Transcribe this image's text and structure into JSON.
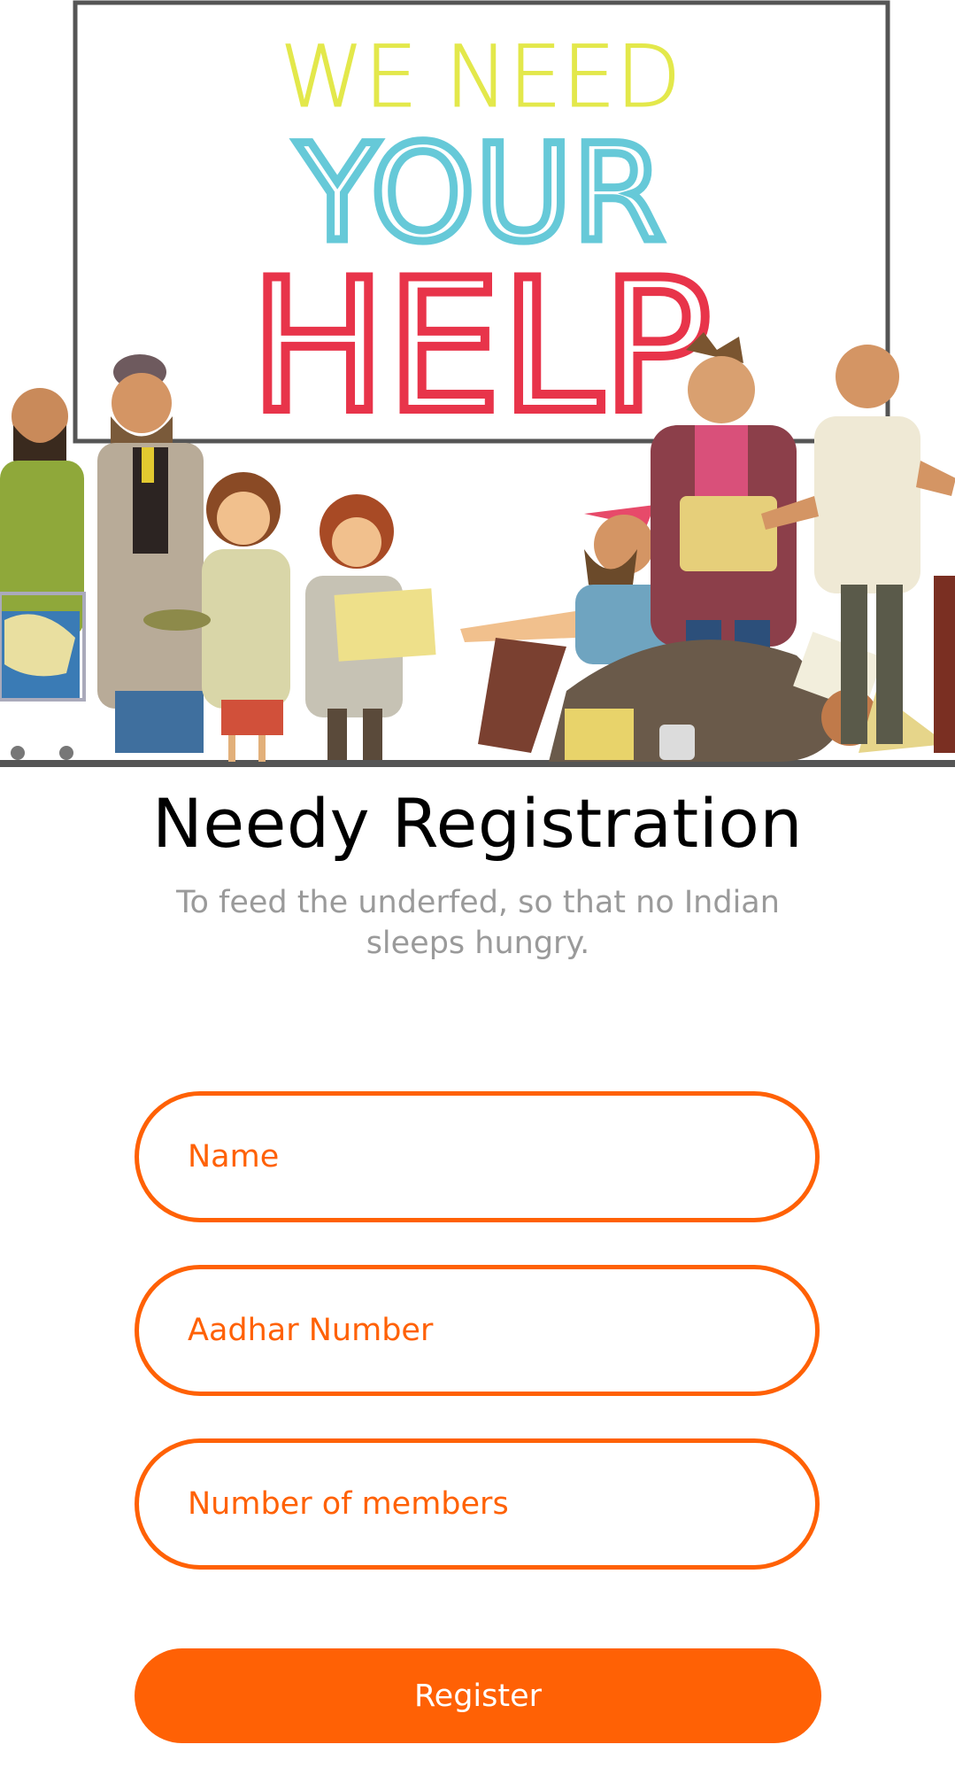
{
  "banner": {
    "line1": "WE NEED",
    "line2": "YOUR",
    "line3": "HELP",
    "colors": {
      "line1": "#E3E84B",
      "line2": "#66C9D8",
      "line3": "#E8344A",
      "frame": "#555555"
    }
  },
  "header": {
    "title": "Needy Registration",
    "subtitle": "To feed the underfed, so that no Indian sleeps hungry."
  },
  "form": {
    "name_placeholder": "Name",
    "aadhar_placeholder": "Aadhar Number",
    "members_placeholder": "Number of members",
    "register_label": "Register"
  },
  "theme": {
    "accent": "#FF6105",
    "subtitle_color": "#9A9A9A"
  }
}
